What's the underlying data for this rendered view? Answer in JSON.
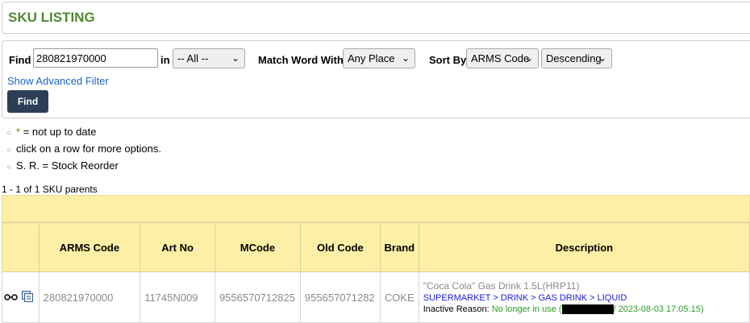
{
  "page": {
    "title": "SKU LISTING"
  },
  "filter": {
    "find_label": "Find",
    "find_value": "280821970000",
    "in_label": "in",
    "in_value": "-- All --",
    "match_label": "Match Word With",
    "match_value": "Any Place",
    "sort_label": "Sort By",
    "sort_value": "ARMS Code",
    "order_value": "Descending",
    "advanced_link": "Show Advanced Filter",
    "find_button": "Find"
  },
  "notes": [
    {
      "prefix": "*",
      "text": " = not up to date"
    },
    {
      "prefix": "",
      "text": "click on a row for more options."
    },
    {
      "prefix": "",
      "text": "S. R. = Stock Reorder"
    }
  ],
  "result_count": "1 - 1 of 1 SKU parents",
  "table": {
    "headers": [
      "ARMS Code",
      "Art No",
      "MCode",
      "Old Code",
      "Brand",
      "Description"
    ],
    "row": {
      "icons": [
        "view-icon",
        "copy-icon"
      ],
      "arms_code": "280821970000",
      "art_no": "11745N009",
      "mcode": "9556570712825",
      "old_code": "955657071282",
      "brand": "COKE",
      "desc_name": "\"Coca Cola\" Gas Drink 1.5L(HRP11)",
      "desc_category": "SUPERMARKET > DRINK > GAS DRINK > LIQUID",
      "inactive_label": "Inactive Reason: ",
      "inactive_reason": "No longer in use (",
      "inactive_date": "/ 2023-08-03 17:05:15)"
    }
  },
  "colors": {
    "title_green": "#4f8a2e",
    "header_yellow": "#fdf0a6",
    "button_navy": "#2c3e56",
    "link_blue": "#1a63c6"
  }
}
